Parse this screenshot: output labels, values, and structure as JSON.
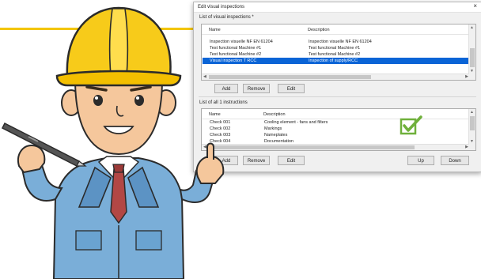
{
  "dialog": {
    "title": "Edit visual inspections",
    "close_symbol": "×",
    "inspections_label": "List of visual inspections *",
    "columns": [
      "Name",
      "Description"
    ],
    "inspections": [
      {
        "name": "Inspection visuelle NF EN 61204",
        "description": "Inspection visuelle NF EN 61204",
        "selected": false
      },
      {
        "name": "Test functional Machine #1",
        "description": "Test functional Machine #1",
        "selected": false
      },
      {
        "name": "Test functional Machine #2",
        "description": "Test functional Machine #2",
        "selected": false
      },
      {
        "name": "Visual inspection T RCC",
        "description": "Inspection of supply/RCC",
        "selected": true
      }
    ],
    "inspection_buttons": {
      "add": "Add",
      "remove": "Remove",
      "edit": "Edit"
    },
    "instructions_label": "List of all 1 instructions",
    "instructions": [
      {
        "name": "Check 001",
        "description": "Cooling element - fans and filters"
      },
      {
        "name": "Check 002",
        "description": "Markings"
      },
      {
        "name": "Check 003",
        "description": "Nameplates"
      },
      {
        "name": "Check 004",
        "description": "Documentation"
      }
    ],
    "instruction_buttons": {
      "add": "Add",
      "remove": "Remove",
      "edit": "Edit",
      "up": "Up",
      "down": "Down"
    }
  },
  "colors": {
    "accent": "#f3c500",
    "selection": "#0a64d6",
    "checkmark": "#6fb03b"
  },
  "icons": {
    "checkmark": "check-box-icon",
    "close": "close-icon"
  }
}
